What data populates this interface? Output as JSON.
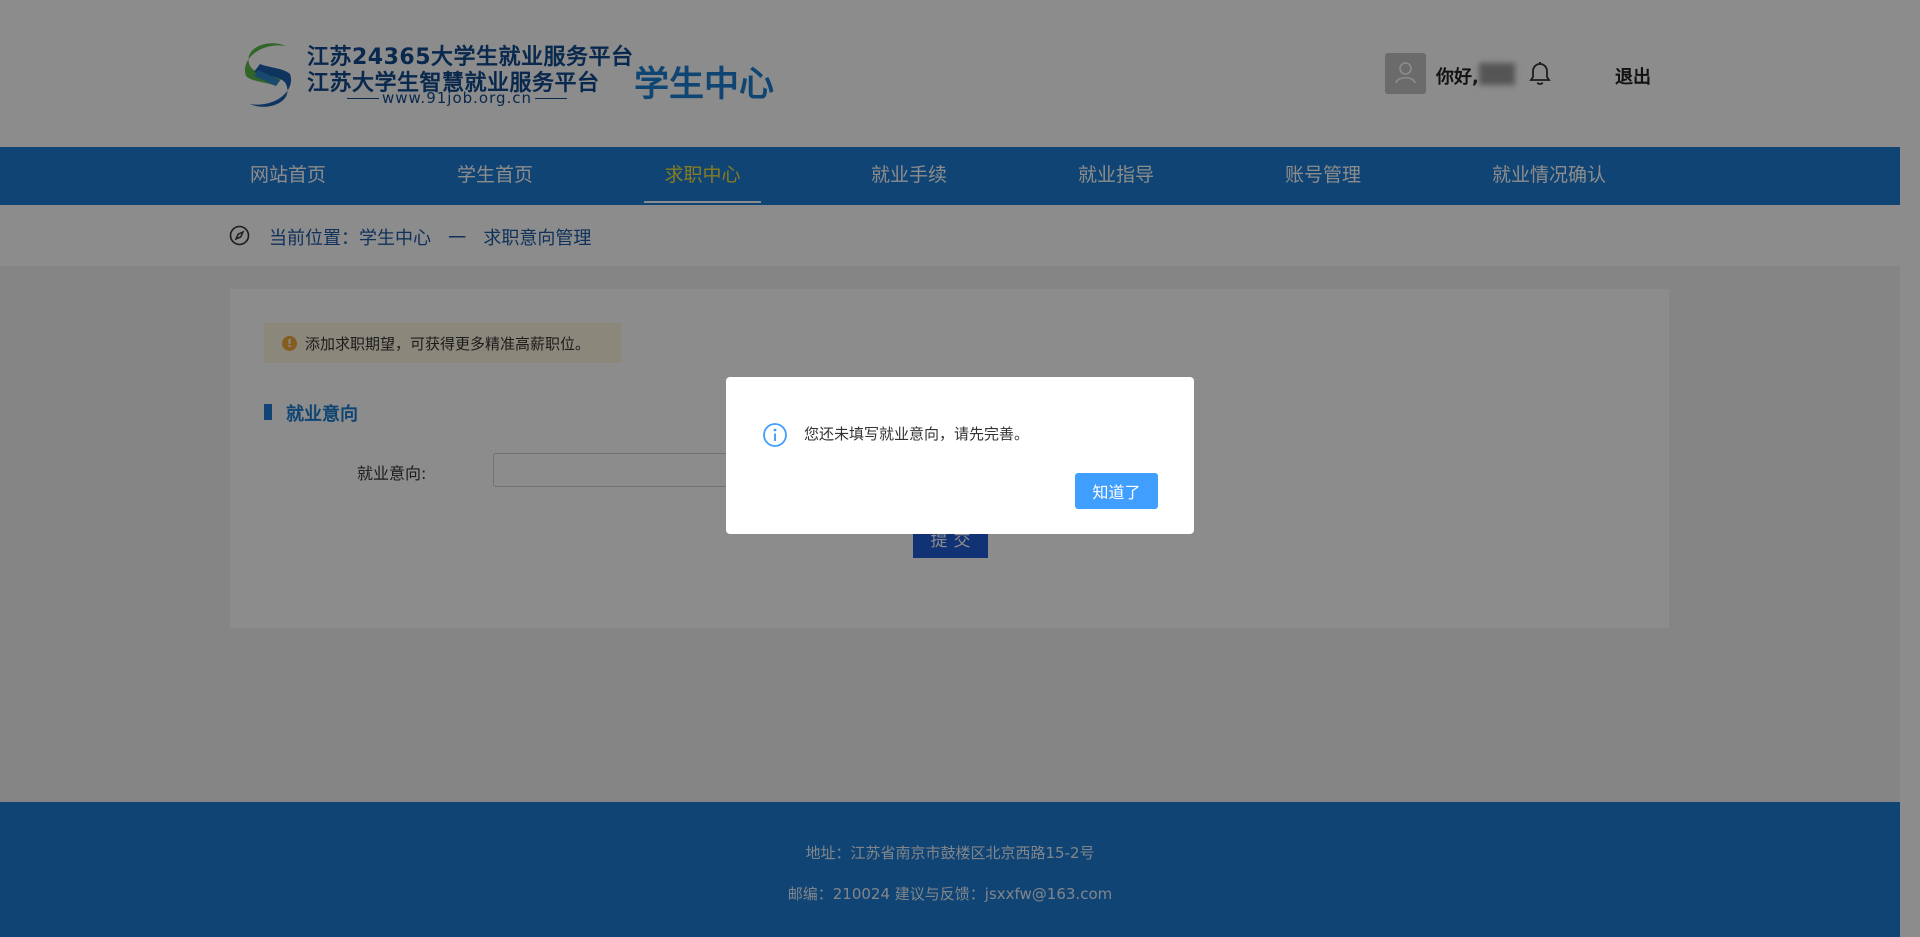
{
  "header": {
    "logo_line1": "江苏24365大学生就业服务平台",
    "logo_line2": "江苏大学生智慧就业服务平台",
    "logo_url": "www.91job.org.cn",
    "center_title": "学生中心",
    "greeting": "你好,",
    "logout_label": "退出",
    "icons": {
      "avatar": "user-avatar-icon",
      "bell": "bell-icon"
    }
  },
  "nav": {
    "items": [
      {
        "label": "网站首页",
        "active": false
      },
      {
        "label": "学生首页",
        "active": false
      },
      {
        "label": "求职中心",
        "active": true
      },
      {
        "label": "就业手续",
        "active": false
      },
      {
        "label": "就业指导",
        "active": false
      },
      {
        "label": "账号管理",
        "active": false
      },
      {
        "label": "就业情况确认",
        "active": false
      }
    ]
  },
  "breadcrumb": {
    "prefix": "当前位置：",
    "path": [
      "学生中心",
      "一",
      "求职意向管理"
    ]
  },
  "main": {
    "tip_icon": "!",
    "tip_text": "添加求职期望，可获得更多精准高薪职位。",
    "section_title": "就业意向",
    "field_label": "就业意向:",
    "field_value": "",
    "submit_label": "提交"
  },
  "footer": {
    "address": "地址：江苏省南京市鼓楼区北京西路15-2号",
    "contact": "邮编：210024 建议与反馈：jsxxfw@163.com"
  },
  "dialog": {
    "message": "您还未填写就业意向，请先完善。",
    "confirm_label": "知道了",
    "icon": "info-icon"
  },
  "colors": {
    "brand_blue": "#1d7cd3",
    "nav_active": "#f6e13b",
    "dialog_button": "#409eff",
    "submit_button": "#1f5ed6"
  }
}
